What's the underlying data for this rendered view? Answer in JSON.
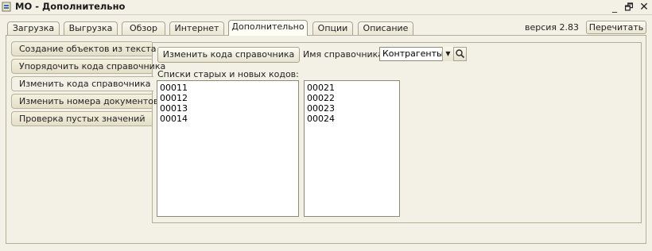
{
  "window": {
    "title": "МО - Дополнительно",
    "minimize_glyph": "_",
    "maximize_glyph": "🗗",
    "close_glyph": "✕"
  },
  "tabs": [
    {
      "label": "Загрузка"
    },
    {
      "label": "Выгрузка"
    },
    {
      "label": "Обзор"
    },
    {
      "label": "Интернет"
    },
    {
      "label": "Дополнительно",
      "active": true
    },
    {
      "label": "Опции"
    },
    {
      "label": "Описание"
    }
  ],
  "version_label": "версия 2.83",
  "reread_button": "Перечитать",
  "side_tabs": [
    {
      "label": "Создание объектов из текста"
    },
    {
      "label": "Упорядочить кода справочника"
    },
    {
      "label": "Изменить кода справочника",
      "active": true
    },
    {
      "label": "Изменить номера документов"
    },
    {
      "label": "Проверка пустых значений"
    }
  ],
  "content": {
    "change_button": "Изменить кода справочника",
    "ref_name_label": "Имя справочника:",
    "ref_name_value": "Контрагенты",
    "lists_label": "Списки старых и новых кодов:",
    "old_codes": [
      "00011",
      "00012",
      "00013",
      "00014"
    ],
    "new_codes": [
      "00021",
      "00022",
      "00023",
      "00024"
    ]
  },
  "icons": {
    "app": "app-icon",
    "dropdown": "chevron-down-icon",
    "search": "search-icon"
  }
}
